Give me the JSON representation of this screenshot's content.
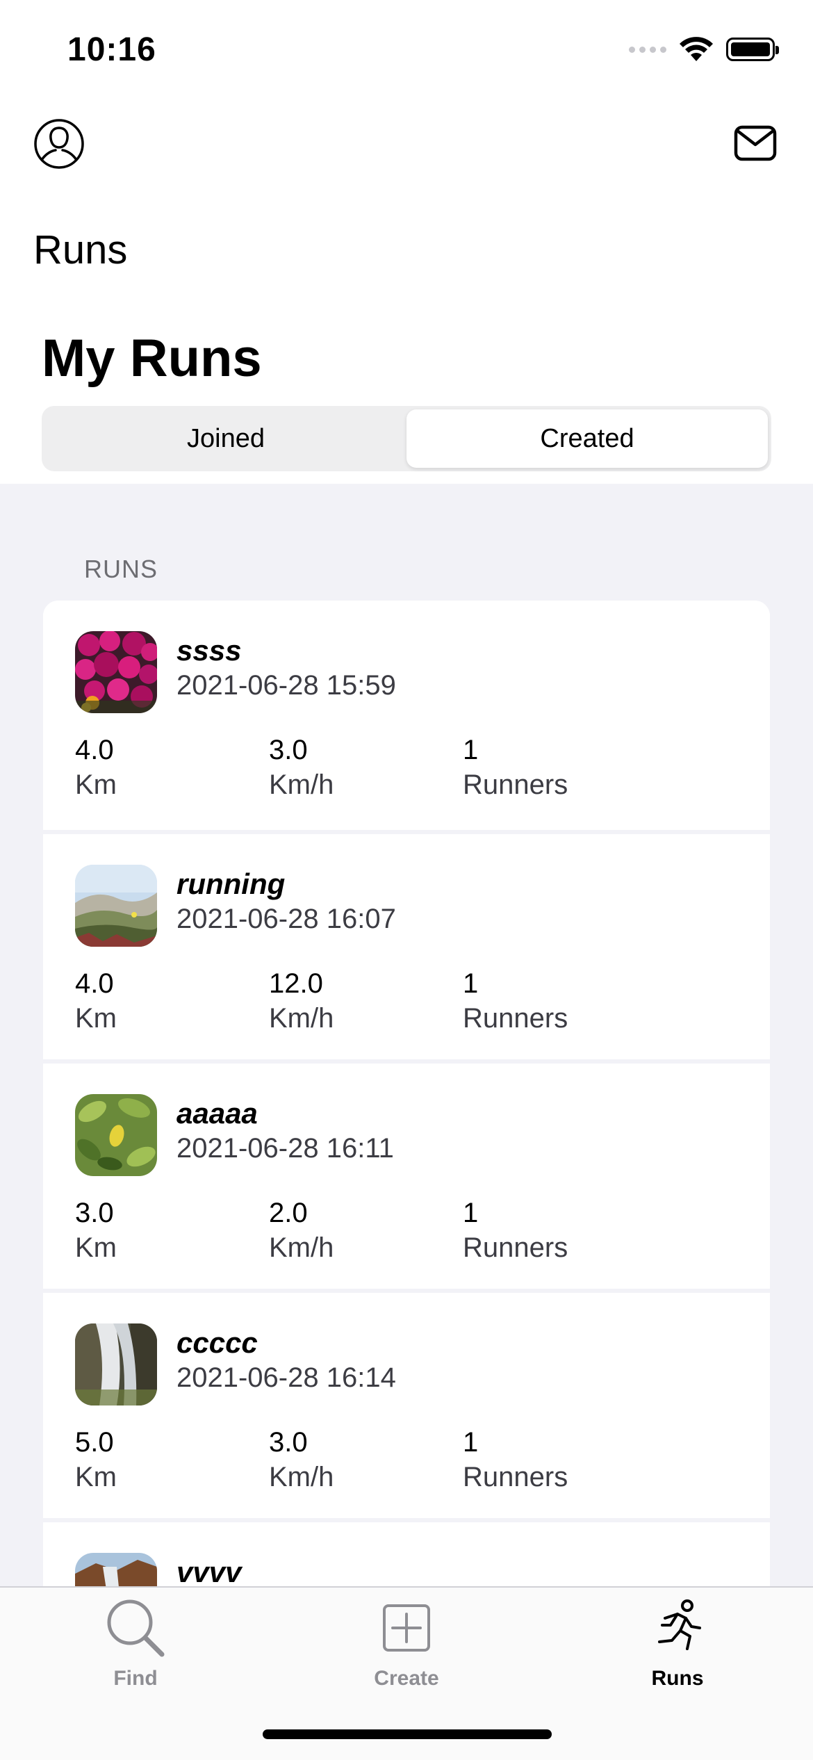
{
  "status": {
    "time": "10:16"
  },
  "nav": {
    "small_title": "Runs",
    "large_title": "My Runs"
  },
  "segments": [
    {
      "label": "Joined",
      "selected": false
    },
    {
      "label": "Created",
      "selected": true
    }
  ],
  "section_header": "RUNS",
  "runs": [
    {
      "name": "ssss",
      "date": "2021-06-28 15:59",
      "distance": "4.0",
      "distance_unit": "Km",
      "speed": "3.0",
      "speed_unit": "Km/h",
      "runners": "1",
      "runners_label": "Runners",
      "thumb": "magenta-flowers"
    },
    {
      "name": "running",
      "date": "2021-06-28 16:07",
      "distance": "4.0",
      "distance_unit": "Km",
      "speed": "12.0",
      "speed_unit": "Km/h",
      "runners": "1",
      "runners_label": "Runners",
      "thumb": "dunes"
    },
    {
      "name": "aaaaa",
      "date": "2021-06-28 16:11",
      "distance": "3.0",
      "distance_unit": "Km",
      "speed": "2.0",
      "speed_unit": "Km/h",
      "runners": "1",
      "runners_label": "Runners",
      "thumb": "leaves"
    },
    {
      "name": "ccccc",
      "date": "2021-06-28 16:14",
      "distance": "5.0",
      "distance_unit": "Km",
      "speed": "3.0",
      "speed_unit": "Km/h",
      "runners": "1",
      "runners_label": "Runners",
      "thumb": "waterfall"
    },
    {
      "name": "vvvv",
      "date": "",
      "distance": "",
      "distance_unit": "",
      "speed": "",
      "speed_unit": "",
      "runners": "",
      "runners_label": "",
      "thumb": "canyon"
    }
  ],
  "tabs": [
    {
      "label": "Find",
      "icon": "magnifier-icon",
      "active": false
    },
    {
      "label": "Create",
      "icon": "plus-square-icon",
      "active": false
    },
    {
      "label": "Runs",
      "icon": "runner-icon",
      "active": true
    }
  ]
}
